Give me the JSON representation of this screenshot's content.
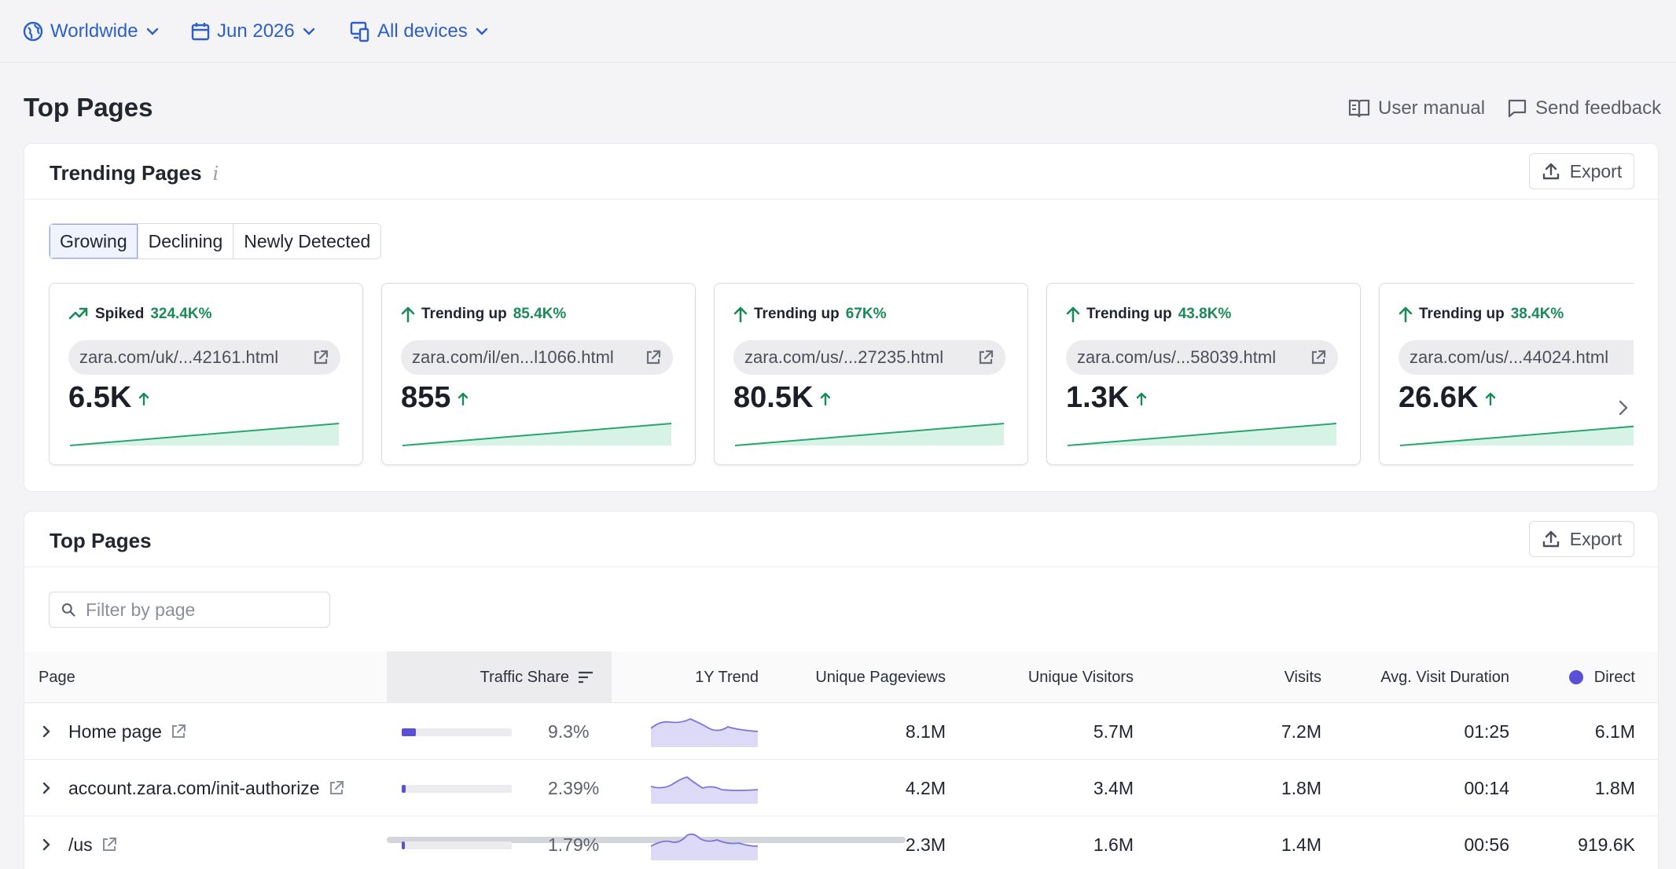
{
  "filters": {
    "region": "Worldwide",
    "date": "Jun 2026",
    "devices": "All devices"
  },
  "header": {
    "title": "Top Pages",
    "user_manual": "User manual",
    "send_feedback": "Send feedback"
  },
  "trending": {
    "title": "Trending Pages",
    "info_icon": "info-icon",
    "export_label": "Export",
    "tabs": [
      "Growing",
      "Declining",
      "Newly Detected"
    ],
    "active_tab": "Growing",
    "tiles": [
      {
        "label": "Spiked",
        "pct": "324.4K%",
        "url": "zara.com/uk/...42161.html",
        "value": "6.5K",
        "icon": "spike-icon"
      },
      {
        "label": "Trending up",
        "pct": "85.4K%",
        "url": "zara.com/il/en...l1066.html",
        "value": "855",
        "icon": "arrow-up-icon"
      },
      {
        "label": "Trending up",
        "pct": "67K%",
        "url": "zara.com/us/...27235.html",
        "value": "80.5K",
        "icon": "arrow-up-icon"
      },
      {
        "label": "Trending up",
        "pct": "43.8K%",
        "url": "zara.com/us/...58039.html",
        "value": "1.3K",
        "icon": "arrow-up-icon"
      },
      {
        "label": "Trending up",
        "pct": "38.4K%",
        "url": "zara.com/us/...44024.html",
        "value": "26.6K",
        "icon": "arrow-up-icon"
      }
    ]
  },
  "top_pages": {
    "title": "Top Pages",
    "export_label": "Export",
    "filter_placeholder": "Filter by page",
    "columns": {
      "page": "Page",
      "traffic_share": "Traffic Share",
      "trend": "1Y Trend",
      "unique_pageviews": "Unique Pageviews",
      "unique_visitors": "Unique Visitors",
      "visits": "Visits",
      "avg_visit_duration": "Avg. Visit Duration",
      "direct": "Direct"
    },
    "rows": [
      {
        "page": "Home page",
        "share": "9.3%",
        "share_value": 0.093,
        "unique_pageviews": "8.1M",
        "unique_visitors": "5.7M",
        "visits": "7.2M",
        "duration": "01:25",
        "direct": "6.1M"
      },
      {
        "page": "account.zara.com/init-authorize",
        "share": "2.39%",
        "share_value": 0.0239,
        "unique_pageviews": "4.2M",
        "unique_visitors": "3.4M",
        "visits": "1.8M",
        "duration": "00:14",
        "direct": "1.8M"
      },
      {
        "page": "/us",
        "share": "1.79%",
        "share_value": 0.0179,
        "unique_pageviews": "2.3M",
        "unique_visitors": "1.6M",
        "visits": "1.4M",
        "duration": "00:56",
        "direct": "919.6K"
      }
    ]
  },
  "colors": {
    "accent_blue": "#2c5fcc",
    "trend_green": "#1a8a57",
    "bar_purple": "#5b4fd6",
    "direct_dot": "#5b4fd6"
  }
}
